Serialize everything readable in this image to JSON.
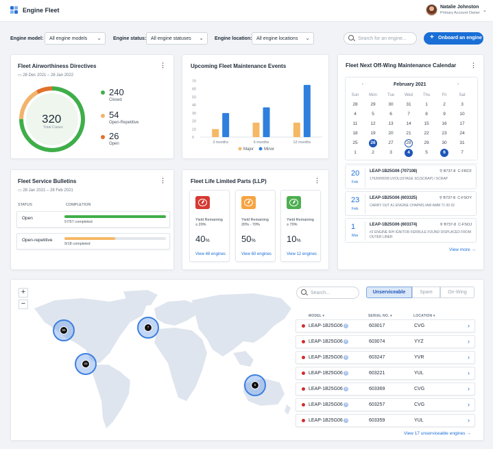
{
  "header": {
    "app_title": "Engine Fleet",
    "user_name": "Natalie Johnston",
    "user_role": "Primary Account Owner"
  },
  "filters": {
    "model_label": "Engine model:",
    "model_value": "All engine models",
    "status_label": "Engine status:",
    "status_value": "All engine statuses",
    "location_label": "Engine location:",
    "location_value": "All engine locations",
    "search_placeholder": "Search for an engine...",
    "onboard_label": "Onboard an engine"
  },
  "airworthiness": {
    "title": "Fleet Airworthiness Directives",
    "dates": "28 Dec 2021  –  28 Jan 2022",
    "total": "320",
    "total_label": "Total Cases",
    "stats": [
      {
        "value": "240",
        "label": "Closed",
        "color": "#3fae49"
      },
      {
        "value": "54",
        "label": "Open-Repetitive",
        "color": "#f2b36b"
      },
      {
        "value": "26",
        "label": "Open",
        "color": "#e2702b"
      }
    ]
  },
  "maintenance": {
    "title": "Upcoming Fleet Maintenance Events",
    "legend": [
      "Major",
      "Minor"
    ]
  },
  "chart_data": {
    "type": "bar",
    "categories": [
      "3 months",
      "6 months",
      "12 months"
    ],
    "series": [
      {
        "name": "Major",
        "values": [
          10,
          18,
          18
        ],
        "color": "#f5b865"
      },
      {
        "name": "Minor",
        "values": [
          30,
          37,
          65
        ],
        "color": "#2f7fde"
      }
    ],
    "yticks": [
      "0",
      "10",
      "20",
      "30",
      "40",
      "50",
      "60",
      "70"
    ],
    "ylim": [
      0,
      70
    ]
  },
  "calendar": {
    "title": "Fleet Next Off-Wing Maintenance Calendar",
    "month": "February 2021",
    "weekdays": [
      "Sun",
      "Mon",
      "Tue",
      "Wed",
      "Thu",
      "Fri",
      "Sat"
    ],
    "weeks": [
      [
        "28",
        "29",
        "30",
        "31",
        "1",
        "2",
        "3"
      ],
      [
        "4",
        "5",
        "6",
        "7",
        "8",
        "9",
        "10"
      ],
      [
        "11",
        "12",
        "13",
        "14",
        "15",
        "16",
        "17"
      ],
      [
        "18",
        "19",
        "20",
        "21",
        "22",
        "23",
        "24"
      ],
      [
        "25",
        "26",
        "27",
        "28",
        "29",
        "30",
        "31"
      ],
      [
        "1",
        "2",
        "3",
        "4",
        "5",
        "6",
        "7"
      ]
    ],
    "events": [
      {
        "day": "20",
        "month": "Feb",
        "title": "LEAP-1B25G06 (707108)",
        "loc": "B737-8",
        "reg": "C-FRCF",
        "desc": "17626H0099 UVOLUSTAGE SC(SCRAP) / SCRAP"
      },
      {
        "day": "23",
        "month": "Feb",
        "title": "LEAP-1B25G06 (603325)",
        "loc": "B737-8",
        "reg": "C-FSOY",
        "desc": "CARRY OUT A1 ENGINE CHAPMS IAW AMM 71 00 02"
      },
      {
        "day": "1",
        "month": "Mar",
        "title": "LEAP-1B25G06 (603374)",
        "loc": "B737-8",
        "reg": "C-FSOJ",
        "desc": "#2 ENGINE R/H IGNITOR FERRULE FOUND DISPLACED FROM OUTER LINER"
      }
    ],
    "view_more": "View more"
  },
  "bulletins": {
    "title": "Fleet Service Bulletins",
    "dates": "28 Jan 2021  –  28 Feb 2021",
    "col_status": "STATUS",
    "col_completion": "COMPLETION",
    "rows": [
      {
        "status": "Open",
        "completed": "57/57 completed",
        "fraction": 1.0,
        "color": "#3fae49"
      },
      {
        "status": "Open-repetitive",
        "completed": "9/18 completed",
        "fraction": 0.5,
        "color": "#f5b865"
      }
    ]
  },
  "llp": {
    "title": "Fleet Life Limited Parts (LLP)",
    "cards": [
      {
        "label_line1": "Yield Remaining",
        "label_line2": "≤ 20%",
        "pct": "40",
        "unit": "%",
        "link": "View 48 engines",
        "color": "#d63a33"
      },
      {
        "label_line1": "Yield Remaining",
        "label_line2": "20% - 70%",
        "pct": "50",
        "unit": "%",
        "link": "View 60 engines",
        "color": "#f5a442"
      },
      {
        "label_line1": "Yield Remaining",
        "label_line2": "≥ 70%",
        "pct": "10",
        "unit": "%",
        "link": "View 12 engines",
        "color": "#4caf50"
      }
    ]
  },
  "map": {
    "clusters": [
      "55",
      "7",
      "20",
      "5"
    ],
    "zoom_in": "+",
    "zoom_out": "−"
  },
  "engines": {
    "search_placeholder": "Search...",
    "tabs": [
      "Unserviceable",
      "Spare",
      "On-Wing"
    ],
    "col_model": "MODEL",
    "col_serial": "SERIAL NO.",
    "col_location": "LOCATION",
    "rows": [
      {
        "model": "LEAP-1B25G06",
        "serial": "603017",
        "location": "CVG"
      },
      {
        "model": "LEAP-1B25G06",
        "serial": "603074",
        "location": "YYZ"
      },
      {
        "model": "LEAP-1B25G06",
        "serial": "603247",
        "location": "YVR"
      },
      {
        "model": "LEAP-1B25G06",
        "serial": "603221",
        "location": "YUL"
      },
      {
        "model": "LEAP-1B25G06",
        "serial": "603369",
        "location": "CVG"
      },
      {
        "model": "LEAP-1B25G06",
        "serial": "603257",
        "location": "CVG"
      },
      {
        "model": "LEAP-1B25G06",
        "serial": "603359",
        "location": "YUL"
      }
    ],
    "view_all": "View 17 unserviceable engines"
  }
}
